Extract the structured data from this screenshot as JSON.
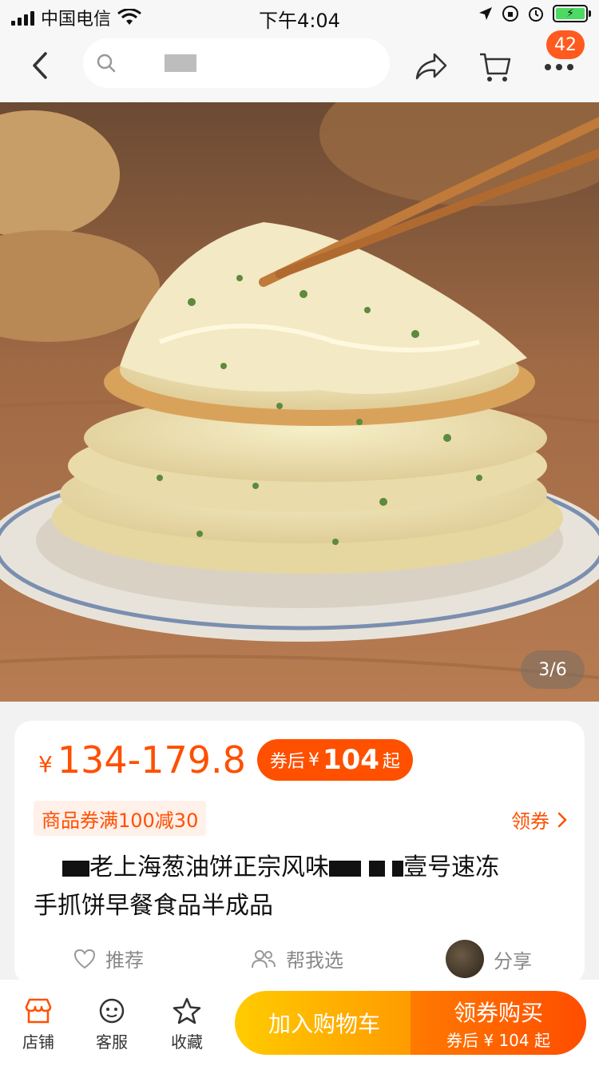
{
  "status_bar": {
    "carrier": "中国电信",
    "time": "下午4:04"
  },
  "nav": {
    "badge_count": "42"
  },
  "product": {
    "image_indicator": "3/6",
    "price_symbol": "¥",
    "price_range": "134-179.8",
    "coupon_prefix": "券后",
    "coupon_symbol": "¥",
    "coupon_price": "104",
    "coupon_suffix": "起",
    "promo": "商品券满100减30",
    "get_coupon": "领券",
    "title_part1": "老上海葱油饼正宗风味",
    "title_part2": "壹号速冻",
    "title_line2": "手抓饼早餐食品半成品"
  },
  "actions": {
    "recommend": "推荐",
    "help_choose": "帮我选",
    "share": "分享"
  },
  "bottom_bar": {
    "shop": "店铺",
    "service": "客服",
    "favorite": "收藏",
    "add_cart": "加入购物车",
    "buy_main": "领券购买",
    "buy_sub": "券后 ¥ 104 起"
  },
  "colors": {
    "accent": "#ff5000",
    "cart_button": "#ffb300"
  }
}
